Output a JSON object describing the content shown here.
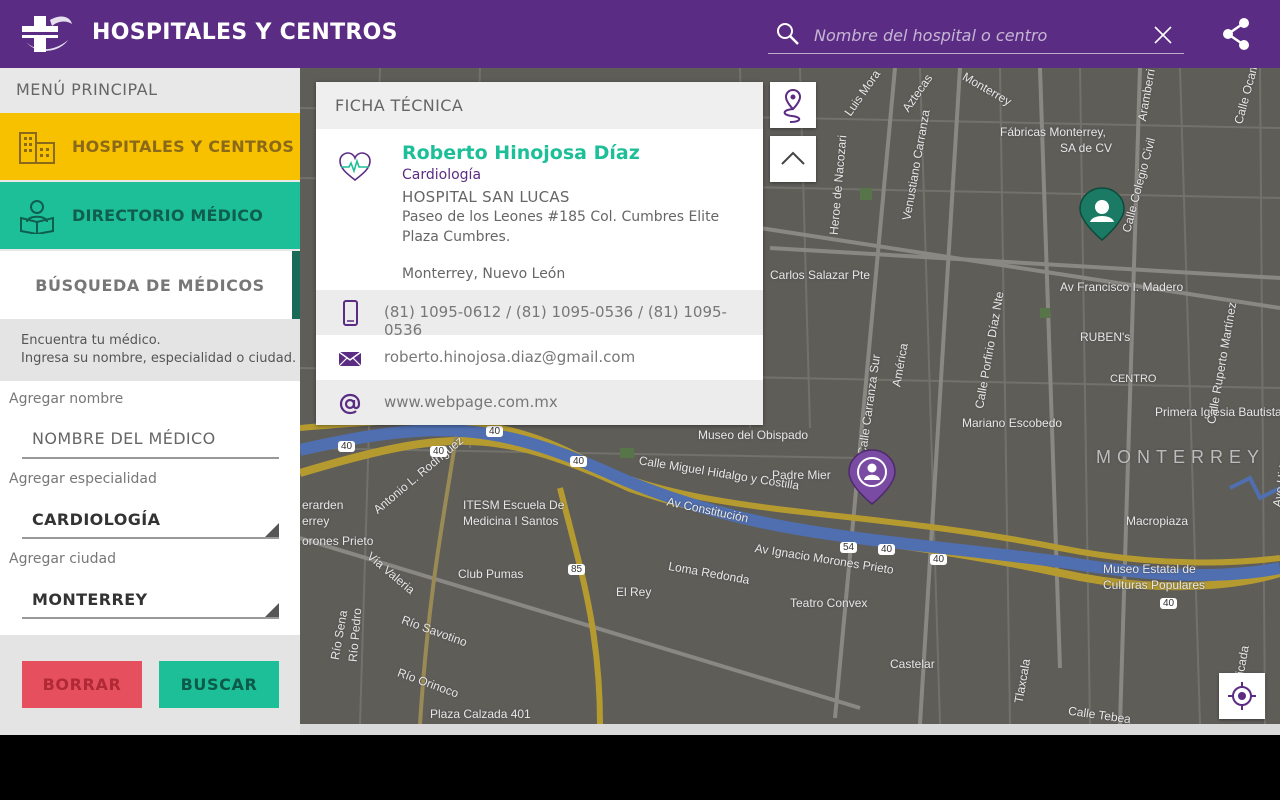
{
  "header": {
    "title": "HOSPITALES Y CENTROS",
    "search_placeholder": "Nombre del hospital o centro"
  },
  "sidebar": {
    "menu_title": "MENÚ PRINCIPAL",
    "nav": [
      {
        "label": "HOSPITALES Y CENTROS"
      },
      {
        "label": "DIRECTORIO MÉDICO"
      }
    ],
    "sub_item": "BÚSQUEDA DE MÉDICOS",
    "help_line1": "Encuentra tu médico.",
    "help_line2": "Ingresa su nombre, especialidad o ciudad.",
    "fields": {
      "name_label": "Agregar nombre",
      "name_placeholder": "NOMBRE DEL MÉDICO",
      "specialty_label": "Agregar especialidad",
      "specialty_value": "CARDIOLOGÍA",
      "city_label": "Agregar ciudad",
      "city_value": "MONTERREY"
    },
    "buttons": {
      "clear": "BORRAR",
      "search": "BUSCAR"
    }
  },
  "card": {
    "header": "FICHA TÉCNICA",
    "name": "Roberto Hinojosa Díaz",
    "specialty": "Cardiología",
    "hospital": "HOSPITAL SAN LUCAS",
    "address_line1": "Paseo de los Leones #185 Col. Cumbres Elite",
    "address_line2": "Plaza Cumbres.",
    "city": "Monterrey, Nuevo León",
    "phone": "(81) 1095-0612 / (81) 1095-0536 / (81) 1095-0536",
    "email": "roberto.hinojosa.diaz@gmail.com",
    "web": "www.webpage.com.mx"
  },
  "map": {
    "labels": [
      "Fábricas Monterrey,",
      "SA de CV",
      "Carlos Salazar Pte",
      "Av Francisco I. Madero",
      "RUBEN's",
      "CENTRO",
      "Primera Iglesia Bautista",
      "Mariano Escobedo",
      "MONTERREY",
      "Museo del Obispado",
      "Calle Miguel Hidalgo y Costilla",
      "Padre Mier",
      "ITESM Escuela De",
      "Medicina I Santos",
      "Av Constitución",
      "Av Ignacio Morones Prieto",
      "Club Pumas",
      "Loma Redonda",
      "El Rey",
      "Teatro Convex",
      "Museo Estatal de",
      "Culturas Populares",
      "Macropiaza",
      "Castelar",
      "Río Savotino",
      "Río Orinoco",
      "Plaza Calzada 401",
      "Antonio L. Rodríguez",
      "Vía Valeria",
      "Venustiano Carranza",
      "Calle Colegio Civil",
      "Calle Porfirio Díaz Nte",
      "Calle Carranza Sur",
      "Calle Ruperto Martínez",
      "Monterrey",
      "Luis Mora",
      "Aztecas",
      "Aramberri",
      "Heroe de Nacozari",
      "orones Prieto",
      "erarden",
      "errey",
      "Río Sena",
      "Tlaxcala",
      "Calle Tebea",
      "Calle Ocampo",
      "Ave Hidalgo",
      "Río Ricada",
      "América",
      "Río Pedro"
    ],
    "road_numbers": [
      "40",
      "40",
      "40",
      "40",
      "85",
      "54",
      "40",
      "40",
      "40"
    ]
  },
  "colors": {
    "header": "#5b2c83",
    "hospitals_nav": "#f8c100",
    "directory_nav": "#1dbf98",
    "clear_button": "#e6505e",
    "search_button": "#1dbf98",
    "doctor_name": "#1dbf98",
    "specialty": "#5b2c83",
    "map_bg": "#5f5d58",
    "river": "#4f6fb1",
    "highway": "#b59b2f"
  },
  "icons": [
    "app-logo-icon",
    "search-icon",
    "close-icon",
    "share-icon",
    "hospital-building-icon",
    "doctor-book-icon",
    "heartbeat-icon",
    "mobile-phone-icon",
    "envelope-icon",
    "at-sign-icon",
    "route-pin-icon",
    "chevron-up-icon",
    "locate-target-icon",
    "doctor-pin-icon"
  ]
}
